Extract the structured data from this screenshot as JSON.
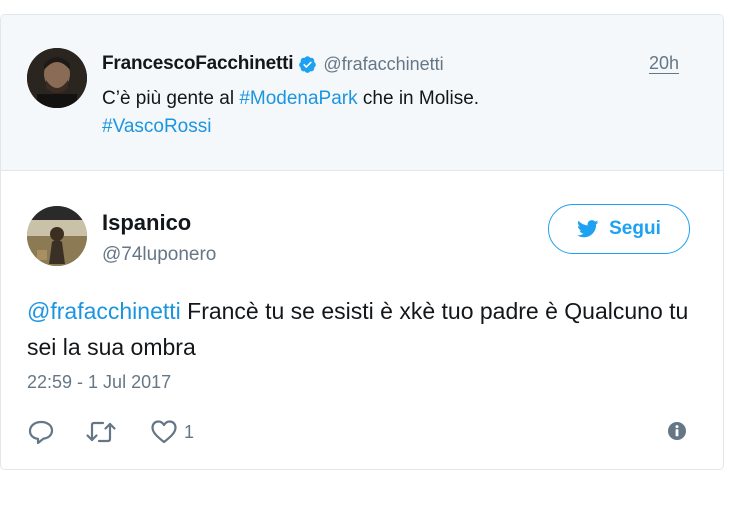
{
  "parent_tweet": {
    "name": "FrancescoFacchinetti",
    "handle": "@frafacchinetti",
    "time": "20h",
    "text_pre": "C’è più gente al ",
    "hashtag1": "#ModenaPark",
    "text_mid": " che in Molise.",
    "hashtag2": "#VascoRossi"
  },
  "tweet": {
    "name": "Ispanico",
    "handle": "@74luponero",
    "follow_label": "Segui",
    "mention": "@frafacchinetti",
    "text": " Francè tu se esisti è xkè tuo padre è Qualcuno tu sei la sua ombra",
    "timestamp": "22:59 - 1 Jul 2017",
    "like_count": "1"
  },
  "colors": {
    "accent": "#1da1f2",
    "link": "#1b95e0",
    "muted": "#657786",
    "parent_bg": "#f5f8fa"
  },
  "icons": {
    "verified": "verified-badge-icon",
    "follow": "twitter-bird-icon",
    "reply": "reply-icon",
    "retweet": "retweet-icon",
    "like": "heart-icon",
    "info": "info-icon"
  }
}
